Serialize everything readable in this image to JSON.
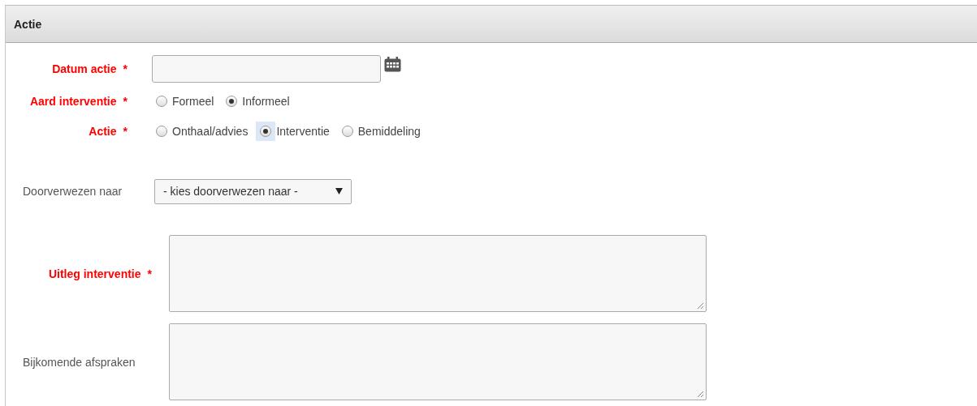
{
  "panel": {
    "title": "Actie"
  },
  "fields": [
    {
      "kind": "date",
      "label": "Datum actie",
      "required": true,
      "mark": "*"
    },
    {
      "kind": "radio",
      "label": "Aard interventie",
      "required": true,
      "mark": "*",
      "options": [
        {
          "label": "Formeel",
          "selected": false,
          "focused": false
        },
        {
          "label": "Informeel",
          "selected": true,
          "focused": false
        }
      ]
    },
    {
      "kind": "radio",
      "label": "Actie",
      "required": true,
      "mark": "*",
      "options": [
        {
          "label": "Onthaal/advies",
          "selected": false,
          "focused": false
        },
        {
          "label": "Interventie",
          "selected": true,
          "focused": true
        },
        {
          "label": "Bemiddeling",
          "selected": false,
          "focused": false
        }
      ]
    },
    {
      "kind": "select",
      "label": "Doorverwezen naar",
      "required": false,
      "value": "- kies doorverwezen naar -"
    },
    {
      "kind": "textarea",
      "label": "Uitleg interventie",
      "required": true,
      "mark": "*"
    },
    {
      "kind": "textarea",
      "label": "Bijkomende afspraken",
      "required": false
    }
  ]
}
